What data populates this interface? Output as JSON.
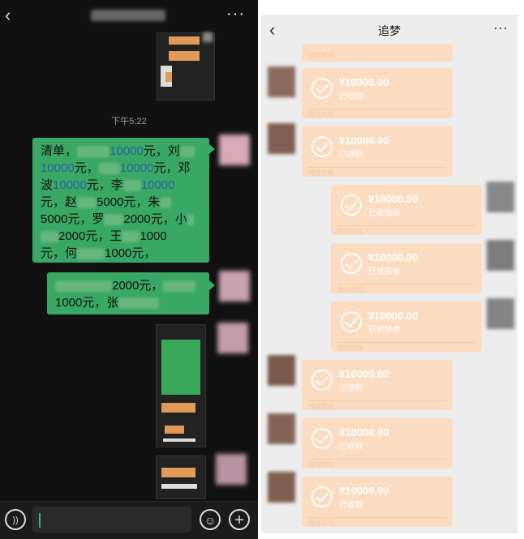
{
  "left": {
    "back_icon": "chevron-left-icon",
    "more_label": "···",
    "time_label": "下午5:22",
    "message_lines": [
      [
        "清单，",
        "10000",
        "元，刘"
      ],
      [
        "10000",
        "元，",
        "10000",
        "元，邓"
      ],
      [
        "波",
        "10000",
        "元，李",
        "10000"
      ],
      [
        "元，赵",
        "5000元，朱"
      ],
      [
        "5000元，罗",
        "2000元，小"
      ],
      [
        "2000元，王",
        "1000"
      ],
      [
        "元，何",
        "1000元，"
      ]
    ],
    "message2_lines": [
      "2000元，",
      "1000元，张"
    ],
    "voice_icon": "voice-icon",
    "emoji_icon": "emoji-icon",
    "plus_icon": "plus-icon"
  },
  "right": {
    "title": "追梦",
    "back_icon": "chevron-left-icon",
    "more_label": "···",
    "footer_label": "微信转账",
    "cards": [
      {
        "amount": "¥10000.00",
        "status": "已收款",
        "side": "left"
      },
      {
        "amount": "¥10000.00",
        "status": "已收款",
        "side": "left"
      },
      {
        "amount": "¥10000.00",
        "status": "已被接收",
        "side": "right"
      },
      {
        "amount": "¥10000.00",
        "status": "已被接收",
        "side": "right"
      },
      {
        "amount": "¥10000.00",
        "status": "已被接收",
        "side": "right"
      },
      {
        "amount": "¥10000.00",
        "status": "已收款",
        "side": "left"
      },
      {
        "amount": "¥10000.00",
        "status": "已收款",
        "side": "left"
      },
      {
        "amount": "¥10000.00",
        "status": "已收款",
        "side": "left"
      }
    ]
  }
}
